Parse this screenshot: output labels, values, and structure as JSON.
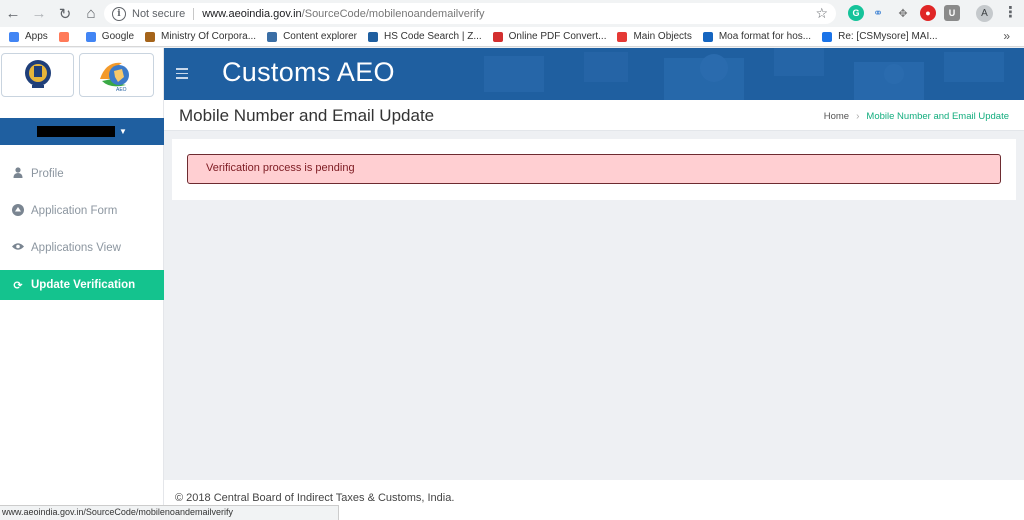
{
  "browser": {
    "security_label": "Not secure",
    "url_host": "www.aeoindia.gov.in",
    "url_path": "/SourceCode/mobilenoandemailverify",
    "profile_initial": "A",
    "bookmarks": [
      {
        "label": "Apps",
        "icon": "apps-grid-icon",
        "color": "#4285f4"
      },
      {
        "label": "",
        "icon": "hubspot-icon",
        "color": "#ff7a59"
      },
      {
        "label": "Google",
        "icon": "google-icon",
        "color": "#4285f4"
      },
      {
        "label": "Ministry Of Corpora...",
        "icon": "emblem-icon",
        "color": "#a5641a"
      },
      {
        "label": "Content explorer",
        "icon": "hand-pointer-icon",
        "color": "#3a6ea5"
      },
      {
        "label": "HS Code Search | Z...",
        "icon": "globe-icon",
        "color": "#1f5fa0"
      },
      {
        "label": "Online PDF Convert...",
        "icon": "pdf-icon",
        "color": "#d32f2f"
      },
      {
        "label": "Main Objects",
        "icon": "c-logo-icon",
        "color": "#e53935"
      },
      {
        "label": "Moa format for hos...",
        "icon": "page-icon",
        "color": "#1565c0"
      },
      {
        "label": "Re: [CSMysore] MAI...",
        "icon": "mail-icon",
        "color": "#1a73e8"
      }
    ],
    "status_url": "www.aeoindia.gov.in/SourceCode/mobilenoandemailverify"
  },
  "app": {
    "brand": "Customs AEO",
    "page_title": "Mobile Number and Email Update",
    "breadcrumb": {
      "home": "Home",
      "current": "Mobile Number and Email Update"
    },
    "nav": [
      {
        "label": "Profile",
        "icon": "user-icon",
        "active": false
      },
      {
        "label": "Application Form",
        "icon": "arrow-up-circle-icon",
        "active": false
      },
      {
        "label": "Applications View",
        "icon": "eye-icon",
        "active": false
      },
      {
        "label": "Update Verification",
        "icon": "refresh-icon",
        "active": true
      }
    ],
    "alert": "Verification process is pending",
    "footer": "© 2018 Central Board of Indirect Taxes & Customs, India."
  },
  "colors": {
    "header_blue": "#1f5fa0",
    "active_green": "#14c38e",
    "alert_bg": "#ffcfd2",
    "breadcrumb_green": "#13ad7e"
  }
}
